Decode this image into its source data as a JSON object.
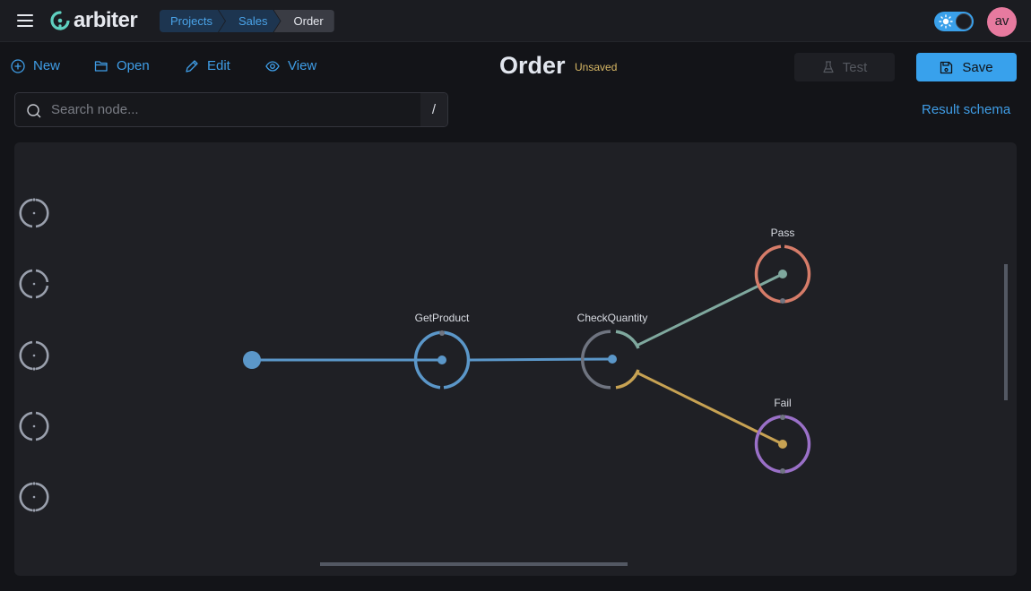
{
  "app": {
    "name": "arbiter",
    "menu_icon": "hamburger-icon",
    "logo_icon": "arbiter-logo-icon"
  },
  "breadcrumb": [
    {
      "label": "Projects"
    },
    {
      "label": "Sales"
    },
    {
      "label": "Order"
    }
  ],
  "header": {
    "theme_toggle_icon": "sun-icon",
    "theme": "light-toggle-on",
    "avatar_initials": "av"
  },
  "toolbar": {
    "new_label": "New",
    "open_label": "Open",
    "edit_label": "Edit",
    "view_label": "View",
    "test_label": "Test",
    "save_label": "Save"
  },
  "document": {
    "title": "Order",
    "status": "Unsaved"
  },
  "search": {
    "placeholder": "Search node...",
    "value": "",
    "shortcut": "/"
  },
  "result_schema_label": "Result schema",
  "colors": {
    "accent": "#38a1ec",
    "unsaved": "#d8b865",
    "getproduct": "#5b97c9",
    "checkquantity_in": "#6f7480",
    "pass_edge": "#7fa89e",
    "fail_edge": "#c7a253",
    "pass_node": "#d67c69",
    "fail_node": "#9a70c8"
  },
  "palette": {
    "items": [
      {
        "name": "node-type-1"
      },
      {
        "name": "node-type-2"
      },
      {
        "name": "node-type-3"
      },
      {
        "name": "node-type-4"
      },
      {
        "name": "node-type-5"
      }
    ]
  },
  "graph": {
    "nodes": [
      {
        "id": "start",
        "label": ""
      },
      {
        "id": "getproduct",
        "label": "GetProduct"
      },
      {
        "id": "checkquantity",
        "label": "CheckQuantity"
      },
      {
        "id": "pass",
        "label": "Pass"
      },
      {
        "id": "fail",
        "label": "Fail"
      }
    ],
    "edges": [
      {
        "from": "start",
        "to": "getproduct"
      },
      {
        "from": "getproduct",
        "to": "checkquantity"
      },
      {
        "from": "checkquantity",
        "to": "pass",
        "branch": "pass"
      },
      {
        "from": "checkquantity",
        "to": "fail",
        "branch": "fail"
      }
    ]
  }
}
